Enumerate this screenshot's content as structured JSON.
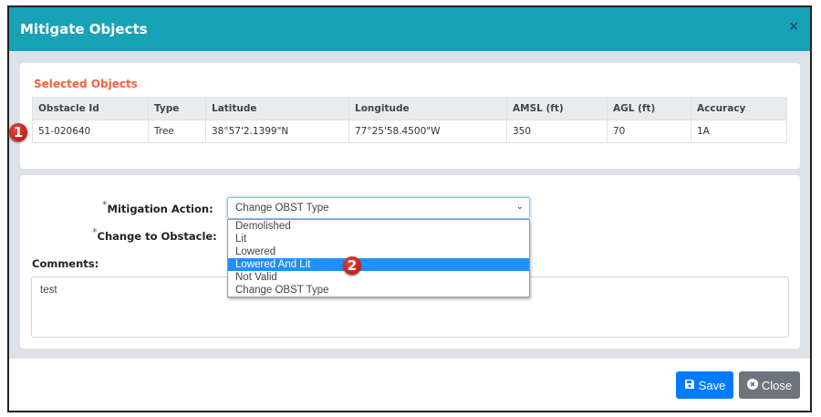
{
  "modal": {
    "title": "Mitigate Objects",
    "close_icon": "×"
  },
  "selected": {
    "title": "Selected Objects",
    "columns": [
      "Obstacle Id",
      "Type",
      "Latitude",
      "Longitude",
      "AMSL (ft)",
      "AGL (ft)",
      "Accuracy"
    ],
    "rows": [
      [
        "51-020640",
        "Tree",
        "38°57'2.1399\"N",
        "77°25'58.4500\"W",
        "350",
        "70",
        "1A"
      ]
    ]
  },
  "annotations": [
    "1",
    "2"
  ],
  "form": {
    "mitigation_label": "Mitigation Action:",
    "required_mark": "*",
    "mitigation_value": "Change OBST Type",
    "options": [
      "Demolished",
      "Lit",
      "Lowered",
      "Lowered And Lit",
      "Not Valid",
      "Change OBST Type"
    ],
    "highlighted_option": "Lowered And Lit",
    "change_label": "Change to Obstacle:",
    "comments_label": "Comments:",
    "comments_value": "test"
  },
  "footer": {
    "save": "Save",
    "close": "Close"
  },
  "colors": {
    "header": "#17a2b8",
    "save": "#007bff",
    "close": "#6c757d",
    "section_title": "#f4623a",
    "highlight": "#1e90ff"
  }
}
